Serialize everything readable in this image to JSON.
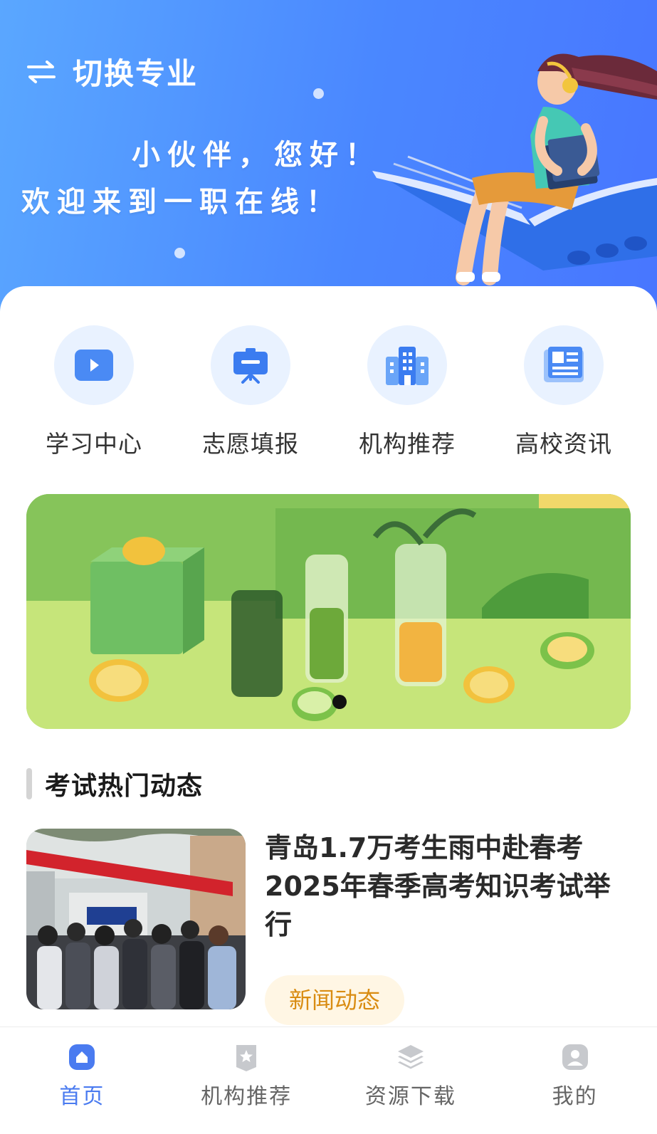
{
  "header": {
    "switch_label": "切换专业",
    "welcome_line1": "小伙伴，您好！",
    "welcome_line2": "欢迎来到一职在线！"
  },
  "quick_nav": [
    {
      "label": "学习中心",
      "icon": "play-video-icon"
    },
    {
      "label": "志愿填报",
      "icon": "presentation-board-icon"
    },
    {
      "label": "机构推荐",
      "icon": "building-icon"
    },
    {
      "label": "高校资讯",
      "icon": "newspaper-icon"
    }
  ],
  "banner": {
    "slide_count": 1,
    "active_slide": 1
  },
  "section": {
    "title": "考试热门动态"
  },
  "news": [
    {
      "title": "青岛1.7万考生雨中赴春考 2025年春季高考知识考试举行",
      "tag": "新闻动态"
    }
  ],
  "tabbar": {
    "active": "首页",
    "items": [
      {
        "label": "首页",
        "icon": "home-icon"
      },
      {
        "label": "机构推荐",
        "icon": "star-badge-icon"
      },
      {
        "label": "资源下载",
        "icon": "layers-icon"
      },
      {
        "label": "我的",
        "icon": "user-icon"
      }
    ]
  },
  "colors": {
    "accent": "#4a7bf0",
    "hero_start": "#5aa7ff",
    "hero_end": "#4876ff",
    "tag_bg": "#fff6e4",
    "tag_text": "#d98c12"
  }
}
